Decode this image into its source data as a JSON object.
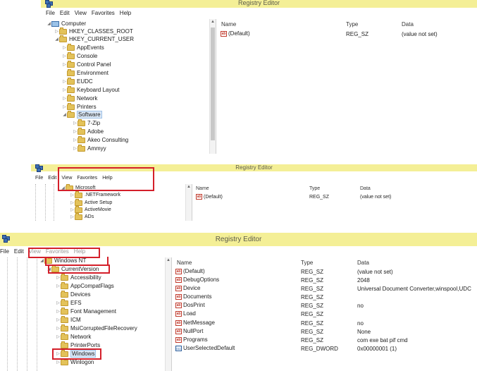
{
  "app_title": "Registry Editor",
  "menu": [
    "File",
    "Edit",
    "View",
    "Favorites",
    "Help"
  ],
  "columns": {
    "name": "Name",
    "type": "Type",
    "data": "Data"
  },
  "panel1": {
    "tree": [
      "Computer",
      "HKEY_CLASSES_ROOT",
      "HKEY_CURRENT_USER",
      "AppEvents",
      "Console",
      "Control Panel",
      "Environment",
      "EUDC",
      "Keyboard Layout",
      "Network",
      "Printers",
      "Software",
      "7-Zip",
      "Adobe",
      "Akeo Consulting",
      "Ammyy"
    ],
    "values": [
      {
        "name": "(Default)",
        "type": "REG_SZ",
        "data": "(value not set)"
      }
    ]
  },
  "panel2": {
    "tree": [
      "Microsoft",
      ".NETFramework",
      "Active Setup",
      "ActiveMovie",
      "ADs"
    ],
    "values": [
      {
        "name": "(Default)",
        "type": "REG_SZ",
        "data": "(value not set)"
      }
    ]
  },
  "panel3": {
    "tree": [
      "Windows NT",
      "CurrentVersion",
      "Accessibility",
      "AppCompatFlags",
      "Devices",
      "EFS",
      "Font Management",
      "ICM",
      "MsiCorruptedFileRecovery",
      "Network",
      "PrinterPorts",
      "Windows",
      "Winlogon"
    ],
    "values": [
      {
        "name": "(Default)",
        "type": "REG_SZ",
        "data": "(value not set)"
      },
      {
        "name": "DebugOptions",
        "type": "REG_SZ",
        "data": "2048"
      },
      {
        "name": "Device",
        "type": "REG_SZ",
        "data": "Universal Document Converter,winspool,UDC"
      },
      {
        "name": "Documents",
        "type": "REG_SZ",
        "data": ""
      },
      {
        "name": "DosPrint",
        "type": "REG_SZ",
        "data": "no"
      },
      {
        "name": "Load",
        "type": "REG_SZ",
        "data": ""
      },
      {
        "name": "NetMessage",
        "type": "REG_SZ",
        "data": "no"
      },
      {
        "name": "NullPort",
        "type": "REG_SZ",
        "data": "None"
      },
      {
        "name": "Programs",
        "type": "REG_SZ",
        "data": "com exe bat pif cmd"
      },
      {
        "name": "UserSelectedDefault",
        "type": "REG_DWORD",
        "data": "0x00000001 (1)"
      }
    ]
  },
  "icons": {
    "app": "registry-app-icon",
    "string_value": "string-value-icon",
    "dword_value": "dword-value-icon",
    "folder": "folder-icon",
    "computer": "computer-icon"
  },
  "colors": {
    "titlebar": "#f4ef96",
    "highlight": "#d41f2a",
    "selection": "#dbe8f7"
  }
}
